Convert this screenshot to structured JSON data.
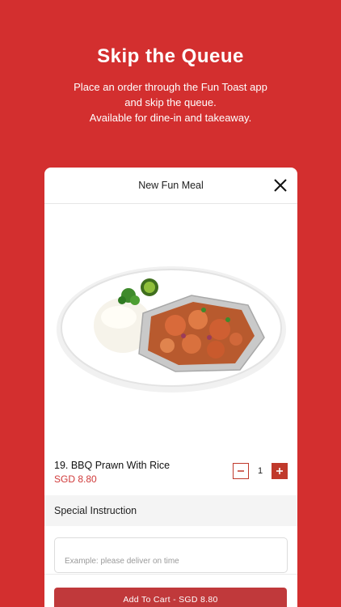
{
  "promo": {
    "headline": "Skip the Queue",
    "lines": [
      "Place an order through the Fun Toast app",
      "and skip the queue.",
      "Available for dine-in and takeaway."
    ]
  },
  "modal": {
    "title": "New Fun Meal",
    "close_icon": "close-icon",
    "item": {
      "name": "19. BBQ Prawn With Rice",
      "price": "SGD 8.80",
      "quantity": "1"
    },
    "special_instruction": {
      "label": "Special Instruction",
      "placeholder": "Example: please deliver on time",
      "value": ""
    },
    "add_to_cart_label": "Add To Cart - SGD 8.80"
  },
  "colors": {
    "background": "#d32f2f",
    "accent": "#c0393b",
    "price": "#d03a3a"
  }
}
